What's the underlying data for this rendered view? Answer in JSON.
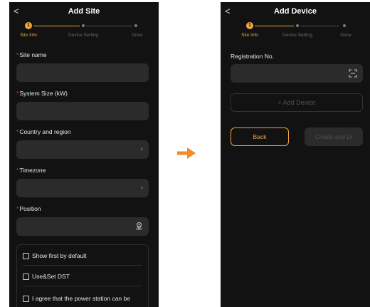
{
  "left": {
    "title": "Add Site",
    "back": "<",
    "steps": [
      "Site Info",
      "Device Setting",
      "Done"
    ],
    "active_step_number": "1",
    "fields": [
      {
        "label": "Site name",
        "required": true
      },
      {
        "label": "System Size (kW)",
        "required": true
      },
      {
        "label": "Country and region",
        "required": true,
        "icon": "chevron-right-icon"
      },
      {
        "label": "Timezone",
        "required": true,
        "icon": "chevron-right-icon"
      },
      {
        "label": "Position",
        "required": true,
        "icon": "location-icon"
      }
    ],
    "options": [
      "Show first by default",
      "Use&Set DST",
      "I agree that the power station can be"
    ]
  },
  "right": {
    "title": "Add Device",
    "back": "<",
    "steps": [
      "Site Info",
      "Device Setting",
      "Done"
    ],
    "active_step_number": "1",
    "registration_label": "Registration No.",
    "registration_icon": "scan-icon",
    "add_device_label": "+ Add Device",
    "back_button": "Back",
    "create_button": "Create and Di"
  },
  "colors": {
    "accent": "#f2a640",
    "required": "#e2393a",
    "background": "#121212",
    "field": "#2b2b2b",
    "arrow": "#f28c28"
  }
}
